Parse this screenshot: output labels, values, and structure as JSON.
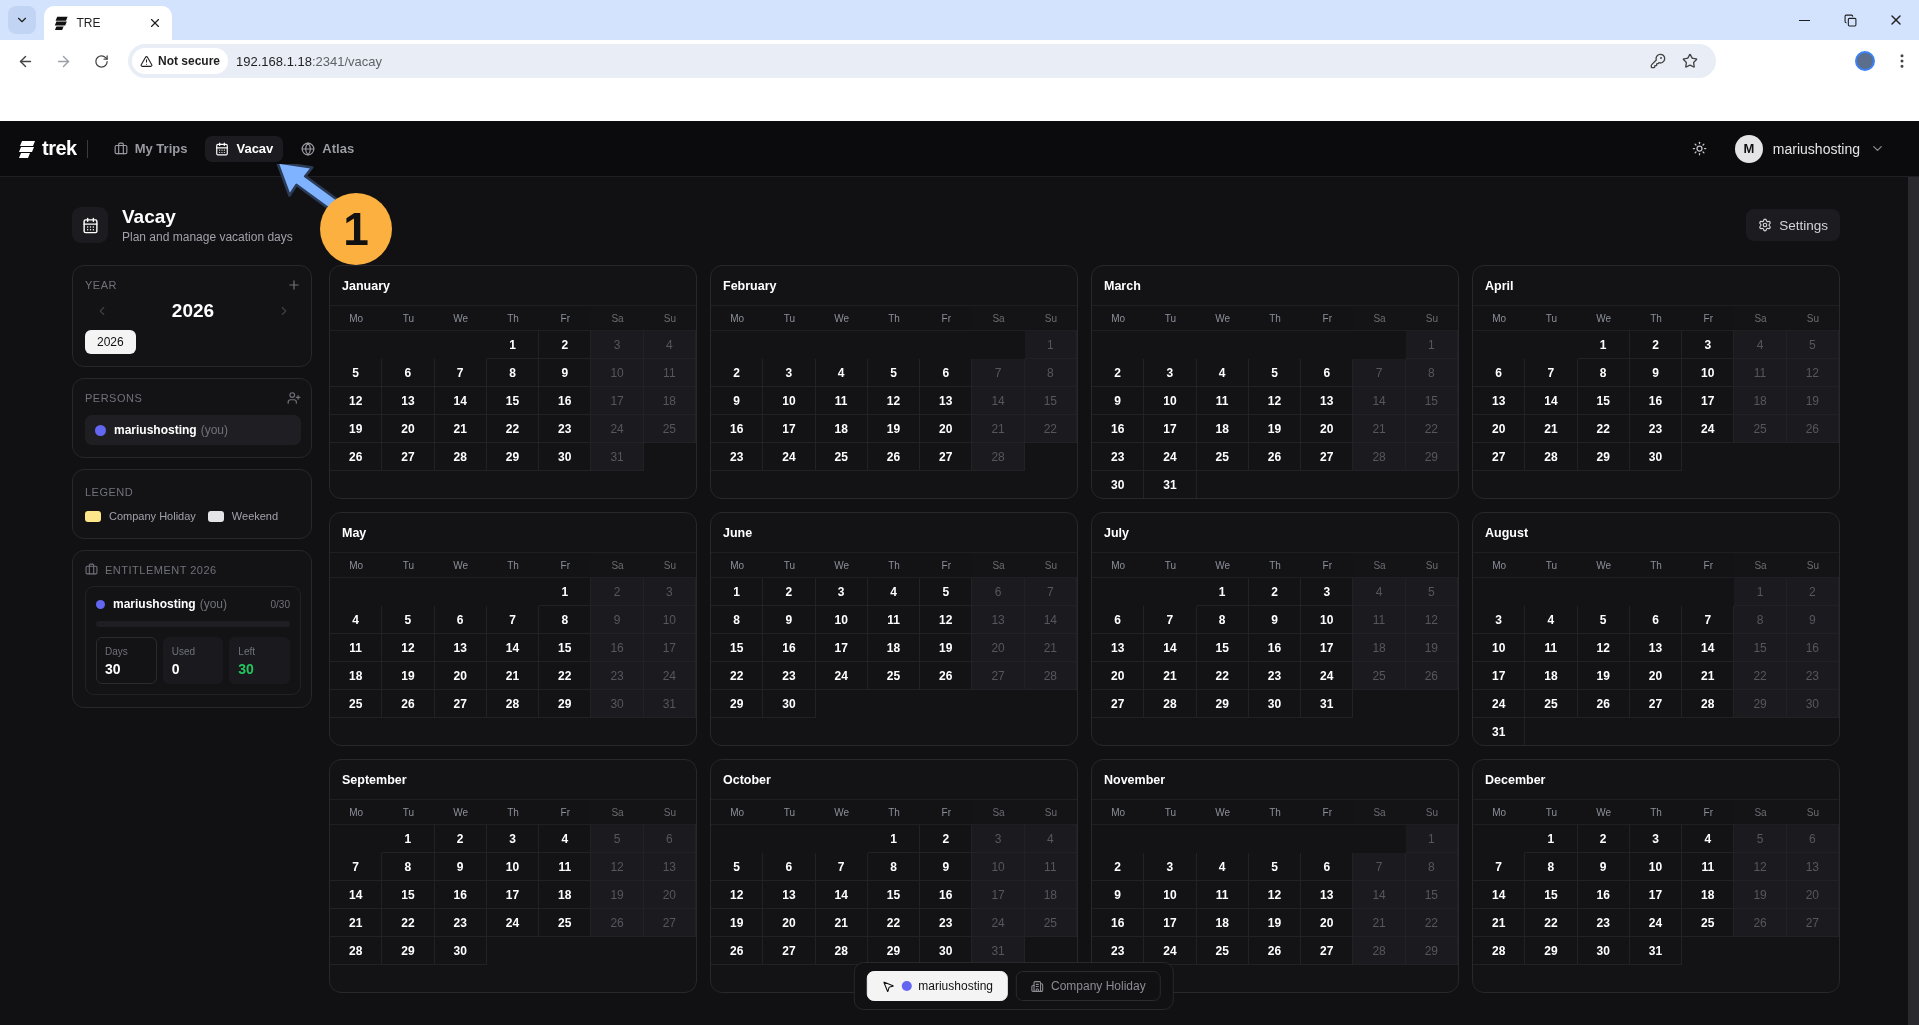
{
  "browser": {
    "tabs": [
      {
        "title": "TRE",
        "selected": true
      }
    ],
    "security": "Not secure",
    "url_host": "192.168.1.18",
    "url_rest": ":2341/vacay"
  },
  "nav": {
    "brand": "trek",
    "items": [
      {
        "kind": "trips",
        "label": "My Trips",
        "selected": false
      },
      {
        "kind": "vacay",
        "label": "Vacav",
        "selected": true
      },
      {
        "kind": "atlas",
        "label": "Atlas",
        "selected": false
      }
    ],
    "user": {
      "initial": "M",
      "name": "mariushosting"
    }
  },
  "header": {
    "title": "Vacay",
    "subtitle": "Plan and manage vacation days",
    "settings": "Settings"
  },
  "annotation": {
    "number": "1"
  },
  "year_panel": {
    "label": "YEAR",
    "year": "2026",
    "chips": [
      {
        "label": "2026",
        "selected": true
      }
    ]
  },
  "persons_panel": {
    "label": "PERSONS",
    "persons": [
      {
        "name": "mariushosting",
        "suffix": "(you)",
        "color": "#6366f1"
      }
    ]
  },
  "legend": {
    "label": "LEGEND",
    "items": [
      {
        "label": "Company Holiday",
        "color": "#fde68a"
      },
      {
        "label": "Weekend",
        "color": "#e4e4e7"
      }
    ]
  },
  "entitlement": {
    "title": "ENTITLEMENT 2026",
    "persons": [
      {
        "name": "mariushosting",
        "suffix": "(you)",
        "color": "#6366f1",
        "count": "0/30",
        "level": 0,
        "stats": [
          {
            "kind": "total",
            "label": "Days",
            "value": "30"
          },
          {
            "kind": "used",
            "label": "Used",
            "value": "0"
          },
          {
            "kind": "left",
            "label": "Left",
            "value": "30"
          }
        ]
      }
    ]
  },
  "months": [
    {
      "name": "January",
      "weekdays": [
        "Mo",
        "Tu",
        "We",
        "Th",
        "Fr",
        "Sa",
        "Su"
      ],
      "weeks": [
        [
          "1",
          "2",
          "3",
          "4"
        ],
        [
          "5",
          "6",
          "7",
          "8",
          "9",
          "10",
          "11"
        ],
        [
          "12",
          "13",
          "14",
          "15",
          "16",
          "17",
          "18"
        ],
        [
          "19",
          "20",
          "21",
          "22",
          "23",
          "24",
          "25"
        ],
        [
          "26",
          "27",
          "28",
          "29",
          "30",
          "31"
        ]
      ]
    },
    {
      "name": "February",
      "weekdays": [
        "Mo",
        "Tu",
        "We",
        "Th",
        "Fr",
        "Sa",
        "Su"
      ],
      "weeks": [
        [
          "1"
        ],
        [
          "2",
          "3",
          "4",
          "5",
          "6",
          "7",
          "8"
        ],
        [
          "9",
          "10",
          "11",
          "12",
          "13",
          "14",
          "15"
        ],
        [
          "16",
          "17",
          "18",
          "19",
          "20",
          "21",
          "22"
        ],
        [
          "23",
          "24",
          "25",
          "26",
          "27",
          "28"
        ]
      ]
    },
    {
      "name": "March",
      "weekdays": [
        "Mo",
        "Tu",
        "We",
        "Th",
        "Fr",
        "Sa",
        "Su"
      ],
      "weeks": [
        [
          "1"
        ],
        [
          "2",
          "3",
          "4",
          "5",
          "6",
          "7",
          "8"
        ],
        [
          "9",
          "10",
          "11",
          "12",
          "13",
          "14",
          "15"
        ],
        [
          "16",
          "17",
          "18",
          "19",
          "20",
          "21",
          "22"
        ],
        [
          "23",
          "24",
          "25",
          "26",
          "27",
          "28",
          "29"
        ],
        [
          "30",
          "31"
        ]
      ]
    },
    {
      "name": "April",
      "weekdays": [
        "Mo",
        "Tu",
        "We",
        "Th",
        "Fr",
        "Sa",
        "Su"
      ],
      "weeks": [
        [
          "1",
          "2",
          "3",
          "4",
          "5"
        ],
        [
          "6",
          "7",
          "8",
          "9",
          "10",
          "11",
          "12"
        ],
        [
          "13",
          "14",
          "15",
          "16",
          "17",
          "18",
          "19"
        ],
        [
          "20",
          "21",
          "22",
          "23",
          "24",
          "25",
          "26"
        ],
        [
          "27",
          "28",
          "29",
          "30"
        ]
      ]
    },
    {
      "name": "May",
      "weekdays": [
        "Mo",
        "Tu",
        "We",
        "Th",
        "Fr",
        "Sa",
        "Su"
      ],
      "weeks": [
        [
          "1",
          "2",
          "3"
        ],
        [
          "4",
          "5",
          "6",
          "7",
          "8",
          "9",
          "10"
        ],
        [
          "11",
          "12",
          "13",
          "14",
          "15",
          "16",
          "17"
        ],
        [
          "18",
          "19",
          "20",
          "21",
          "22",
          "23",
          "24"
        ],
        [
          "25",
          "26",
          "27",
          "28",
          "29",
          "30",
          "31"
        ]
      ]
    },
    {
      "name": "June",
      "weekdays": [
        "Mo",
        "Tu",
        "We",
        "Th",
        "Fr",
        "Sa",
        "Su"
      ],
      "weeks": [
        [
          "1",
          "2",
          "3",
          "4",
          "5",
          "6",
          "7"
        ],
        [
          "8",
          "9",
          "10",
          "11",
          "12",
          "13",
          "14"
        ],
        [
          "15",
          "16",
          "17",
          "18",
          "19",
          "20",
          "21"
        ],
        [
          "22",
          "23",
          "24",
          "25",
          "26",
          "27",
          "28"
        ],
        [
          "29",
          "30"
        ]
      ]
    },
    {
      "name": "July",
      "weekdays": [
        "Mo",
        "Tu",
        "We",
        "Th",
        "Fr",
        "Sa",
        "Su"
      ],
      "weeks": [
        [
          "1",
          "2",
          "3",
          "4",
          "5"
        ],
        [
          "6",
          "7",
          "8",
          "9",
          "10",
          "11",
          "12"
        ],
        [
          "13",
          "14",
          "15",
          "16",
          "17",
          "18",
          "19"
        ],
        [
          "20",
          "21",
          "22",
          "23",
          "24",
          "25",
          "26"
        ],
        [
          "27",
          "28",
          "29",
          "30",
          "31"
        ]
      ]
    },
    {
      "name": "August",
      "weekdays": [
        "Mo",
        "Tu",
        "We",
        "Th",
        "Fr",
        "Sa",
        "Su"
      ],
      "weeks": [
        [
          "1",
          "2"
        ],
        [
          "3",
          "4",
          "5",
          "6",
          "7",
          "8",
          "9"
        ],
        [
          "10",
          "11",
          "12",
          "13",
          "14",
          "15",
          "16"
        ],
        [
          "17",
          "18",
          "19",
          "20",
          "21",
          "22",
          "23"
        ],
        [
          "24",
          "25",
          "26",
          "27",
          "28",
          "29",
          "30"
        ],
        [
          "31"
        ]
      ]
    },
    {
      "name": "September",
      "weekdays": [
        "Mo",
        "Tu",
        "We",
        "Th",
        "Fr",
        "Sa",
        "Su"
      ],
      "weeks": [
        [
          "1",
          "2",
          "3",
          "4",
          "5",
          "6"
        ],
        [
          "7",
          "8",
          "9",
          "10",
          "11",
          "12",
          "13"
        ],
        [
          "14",
          "15",
          "16",
          "17",
          "18",
          "19",
          "20"
        ],
        [
          "21",
          "22",
          "23",
          "24",
          "25",
          "26",
          "27"
        ],
        [
          "28",
          "29",
          "30"
        ]
      ]
    },
    {
      "name": "October",
      "weekdays": [
        "Mo",
        "Tu",
        "We",
        "Th",
        "Fr",
        "Sa",
        "Su"
      ],
      "weeks": [
        [
          "1",
          "2",
          "3",
          "4"
        ],
        [
          "5",
          "6",
          "7",
          "8",
          "9",
          "10",
          "11"
        ],
        [
          "12",
          "13",
          "14",
          "15",
          "16",
          "17",
          "18"
        ],
        [
          "19",
          "20",
          "21",
          "22",
          "23",
          "24",
          "25"
        ],
        [
          "26",
          "27",
          "28",
          "29",
          "30",
          "31"
        ]
      ]
    },
    {
      "name": "November",
      "weekdays": [
        "Mo",
        "Tu",
        "We",
        "Th",
        "Fr",
        "Sa",
        "Su"
      ],
      "weeks": [
        [
          "1"
        ],
        [
          "2",
          "3",
          "4",
          "5",
          "6",
          "7",
          "8"
        ],
        [
          "9",
          "10",
          "11",
          "12",
          "13",
          "14",
          "15"
        ],
        [
          "16",
          "17",
          "18",
          "19",
          "20",
          "21",
          "22"
        ],
        [
          "23",
          "24",
          "25",
          "26",
          "27",
          "28",
          "29"
        ]
      ]
    },
    {
      "name": "December",
      "weekdays": [
        "Mo",
        "Tu",
        "We",
        "Th",
        "Fr",
        "Sa",
        "Su"
      ],
      "weeks": [
        [
          "1",
          "2",
          "3",
          "4",
          "5",
          "6"
        ],
        [
          "7",
          "8",
          "9",
          "10",
          "11",
          "12",
          "13"
        ],
        [
          "14",
          "15",
          "16",
          "17",
          "18",
          "19",
          "20"
        ],
        [
          "21",
          "22",
          "23",
          "24",
          "25",
          "26",
          "27"
        ],
        [
          "28",
          "29",
          "30",
          "31"
        ]
      ]
    }
  ],
  "toolbar": [
    {
      "kind": "person",
      "label": "mariushosting",
      "color": "#6366f1",
      "selected": true
    },
    {
      "kind": "holiday",
      "label": "Company Holiday",
      "selected": false
    }
  ]
}
